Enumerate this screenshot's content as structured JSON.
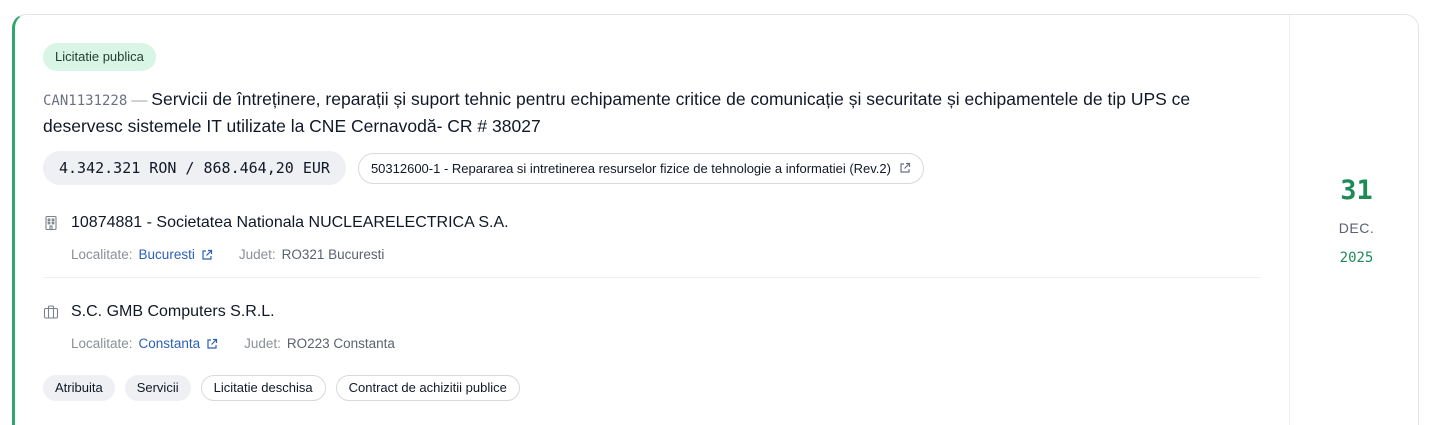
{
  "card": {
    "type_badge": "Licitatie publica",
    "code": "CAN1131228",
    "separator": "—",
    "title": "Servicii de întreținere, reparații și suport tehnic pentru echipamente critice de comunicație și securitate și echipamentele de tip UPS ce deservesc sistemele IT utilizate la CNE Cernavodă- CR # 38027",
    "amount": "4.342.321 RON / 868.464,20 EUR",
    "cpv": "50312600-1 - Repararea si intretinerea resurselor fizice de tehnologie a informatiei (Rev.2)",
    "authority": {
      "icon": "building-icon",
      "name": "10874881 - Societatea Nationala NUCLEARELECTRICA S.A.",
      "localitate_label": "Localitate:",
      "localitate": "Bucuresti",
      "judet_label": "Judet:",
      "judet": "RO321 Bucuresti"
    },
    "supplier": {
      "icon": "briefcase-icon",
      "name": "S.C. GMB Computers S.R.L.",
      "localitate_label": "Localitate:",
      "localitate": "Constanta",
      "judet_label": "Judet:",
      "judet": "RO223 Constanta"
    },
    "tags": [
      "Atribuita",
      "Servicii",
      "Licitatie deschisa",
      "Contract de achizitii publice"
    ],
    "date": {
      "day": "31",
      "month": "DEC.",
      "year": "2025"
    },
    "colors": {
      "accent": "#2fa56b",
      "badge_bg": "#d8f5e6",
      "link": "#2b5fb8",
      "date": "#1f8a59"
    }
  }
}
